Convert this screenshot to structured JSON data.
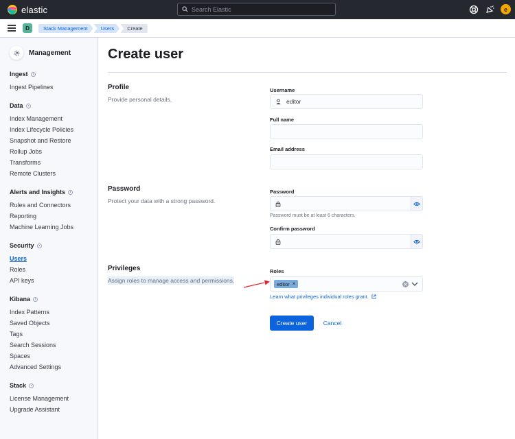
{
  "header": {
    "brand": "elastic",
    "search_placeholder": "Search Elastic",
    "avatar_initial": "e"
  },
  "subbar": {
    "space_initial": "D",
    "breadcrumbs": [
      "Stack Management",
      "Users",
      "Create"
    ]
  },
  "sidebar": {
    "title": "Management",
    "groups": [
      {
        "title": "Ingest",
        "items": [
          "Ingest Pipelines"
        ]
      },
      {
        "title": "Data",
        "items": [
          "Index Management",
          "Index Lifecycle Policies",
          "Snapshot and Restore",
          "Rollup Jobs",
          "Transforms",
          "Remote Clusters"
        ]
      },
      {
        "title": "Alerts and Insights",
        "items": [
          "Rules and Connectors",
          "Reporting",
          "Machine Learning Jobs"
        ]
      },
      {
        "title": "Security",
        "items": [
          "Users",
          "Roles",
          "API keys"
        ],
        "active": "Users"
      },
      {
        "title": "Kibana",
        "items": [
          "Index Patterns",
          "Saved Objects",
          "Tags",
          "Search Sessions",
          "Spaces",
          "Advanced Settings"
        ]
      },
      {
        "title": "Stack",
        "items": [
          "License Management",
          "Upgrade Assistant"
        ]
      }
    ]
  },
  "form": {
    "title": "Create user",
    "profile": {
      "title": "Profile",
      "description": "Provide personal details.",
      "username_label": "Username",
      "username_value": "editor",
      "fullname_label": "Full name",
      "fullname_value": "",
      "email_label": "Email address",
      "email_value": ""
    },
    "password": {
      "title": "Password",
      "description": "Protect your data with a strong password.",
      "password_label": "Password",
      "password_help": "Password must be at least 6 characters.",
      "confirm_label": "Confirm password"
    },
    "privileges": {
      "title": "Privileges",
      "description": "Assign roles to manage access and permissions.",
      "roles_label": "Roles",
      "selected_roles": [
        "editor"
      ],
      "learn_link": "Learn what privileges individual roles grant."
    },
    "buttons": {
      "create": "Create user",
      "cancel": "Cancel"
    }
  },
  "colors": {
    "header_bg": "#25282f",
    "primary": "#0b64dd",
    "annotation_arrow": "#e7202a"
  }
}
